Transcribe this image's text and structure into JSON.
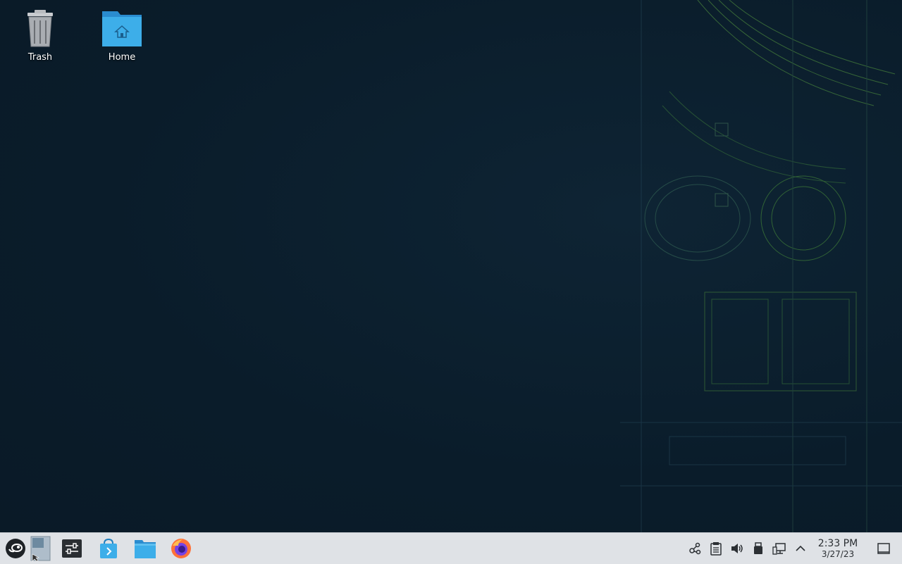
{
  "desktop": {
    "icons": [
      {
        "label": "Trash",
        "icon": "trash-icon"
      },
      {
        "label": "Home",
        "icon": "home-folder-icon"
      }
    ]
  },
  "taskbar": {
    "launchers": [
      "application-launcher-icon",
      "pager-icon",
      "system-settings-icon",
      "discover-store-icon",
      "file-manager-icon",
      "firefox-icon"
    ],
    "tray": [
      "network-share-icon",
      "clipboard-icon",
      "volume-icon",
      "usb-device-icon",
      "network-icon",
      "show-hidden-icons-chevron-icon",
      "show-desktop-icon"
    ],
    "clock": {
      "time": "2:33 PM",
      "date": "3/27/23"
    }
  },
  "colors": {
    "desktop_bg": "#0b1d2b",
    "taskbar_bg": "#dfe2e6",
    "folder_blue": "#3daee9",
    "accent_green": "#73ba25"
  }
}
